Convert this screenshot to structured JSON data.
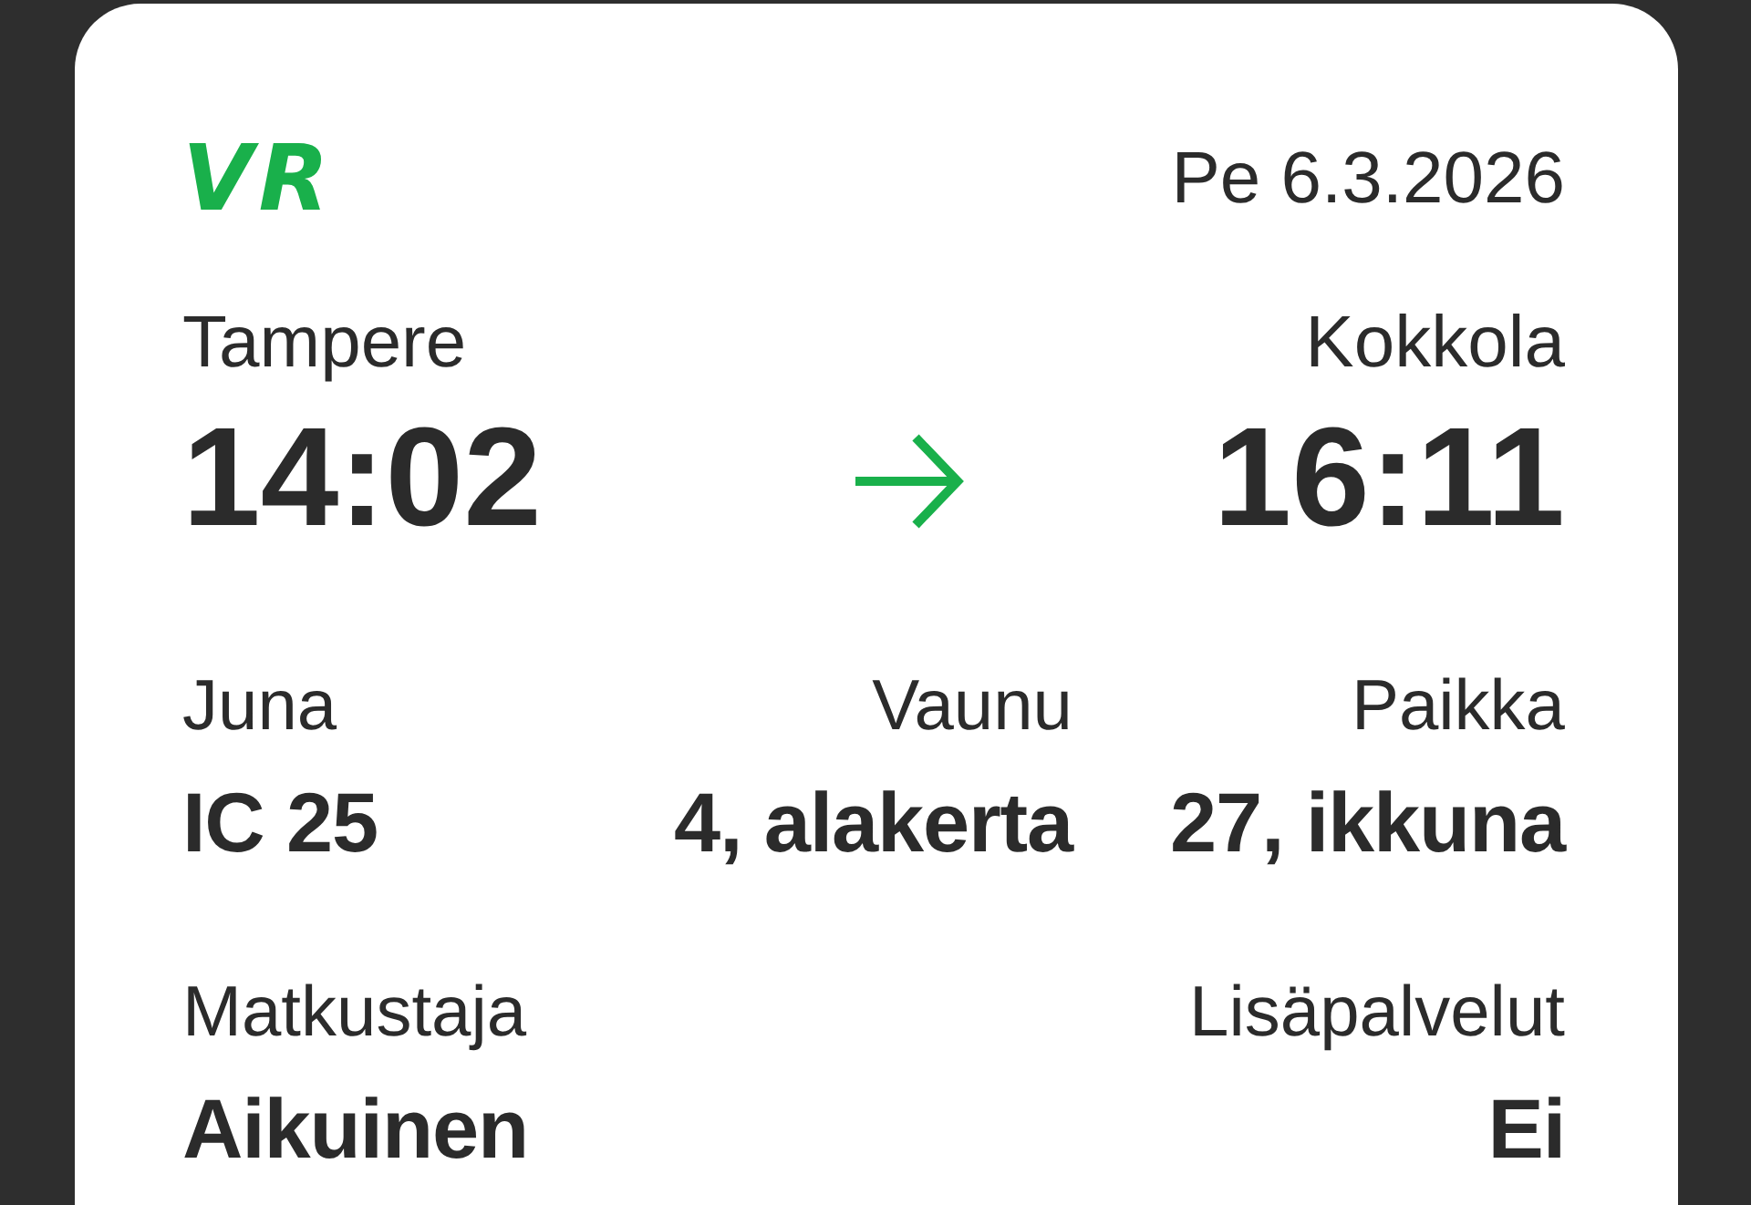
{
  "logo": {
    "text": "VR"
  },
  "date": "Pe 6.3.2026",
  "journey": {
    "departure": {
      "station": "Tampere",
      "time": "14:02"
    },
    "arrival": {
      "station": "Kokkola",
      "time": "16:11"
    }
  },
  "details": [
    {
      "label": "Juna",
      "value": "IC 25"
    },
    {
      "label": "Vaunu",
      "value": "4, alakerta"
    },
    {
      "label": "Paikka",
      "value": "27, ikkuna"
    }
  ],
  "extras": [
    {
      "label": "Matkustaja",
      "value": "Aikuinen"
    },
    {
      "label": "Lisäpalvelut",
      "value": "Ei"
    }
  ]
}
